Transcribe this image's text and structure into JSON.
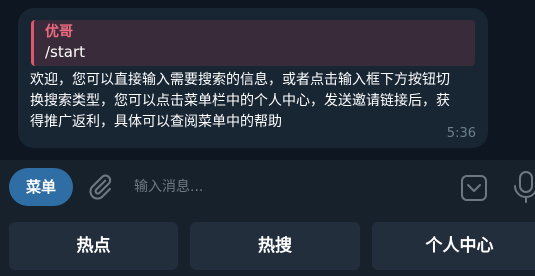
{
  "message": {
    "reply_author": "优哥",
    "reply_text": "/start",
    "text": "欢迎，您可以直接输入需要搜索的信息，或者点击输入框下方按钮切换搜索类型，您可以点击菜单栏中的个人中心，发送邀请链接后，获得推广返利，具体可以查阅菜单中的帮助",
    "time": "5:36"
  },
  "composer": {
    "menu_label": "菜单",
    "placeholder": "输入消息...",
    "icons": [
      "paperclip-icon",
      "sticker-icon",
      "microphone-icon"
    ]
  },
  "keyboard": {
    "buttons": [
      "热点",
      "热搜",
      "个人中心"
    ]
  },
  "colors": {
    "background": "#0e1621",
    "bubble": "#182533",
    "reply_accent": "#e0566f",
    "menu_button": "#2f6ea5",
    "keyboard_button": "#232e3c"
  }
}
